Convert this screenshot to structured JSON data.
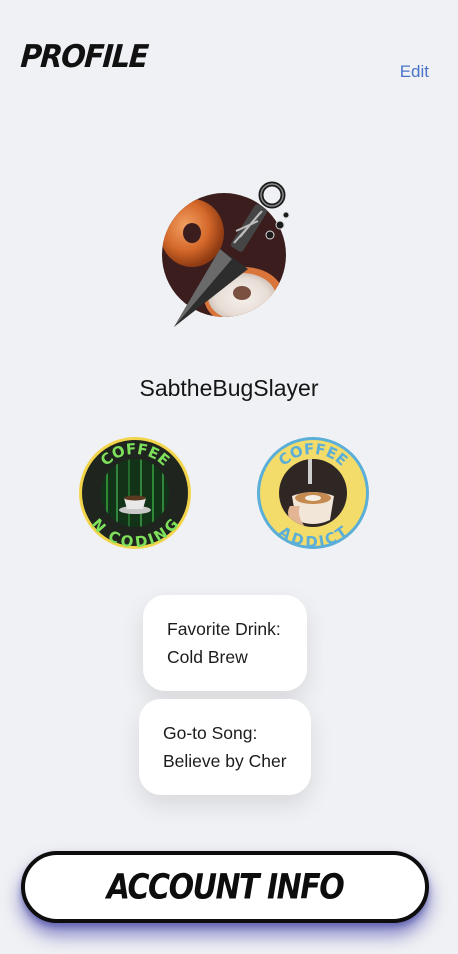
{
  "header": {
    "title": "PROFILE",
    "edit_label": "Edit"
  },
  "profile": {
    "avatar_icon": "bagel-kunai-icon",
    "username": "SabtheBugSlayer"
  },
  "badges": [
    {
      "icon": "coffee-n-coding-badge-icon",
      "top_text": "COFFEE",
      "bottom_text": "N CODING"
    },
    {
      "icon": "coffee-addict-badge-icon",
      "top_text": "COFFEE",
      "bottom_text": "ADDICT"
    }
  ],
  "cards": {
    "drink": {
      "label": "Favorite Drink:",
      "value": "Cold Brew"
    },
    "song": {
      "label": "Go-to Song:",
      "value": "Believe by Cher"
    }
  },
  "footer": {
    "button_label": "ACCOUNT INFO"
  },
  "colors": {
    "background": "#f0f1f4",
    "edit_link": "#4a74c9",
    "button_shadow": "#3b3bbf",
    "badge_green_text": "#7ee05a",
    "badge_blue_ring": "#5aaed8",
    "badge_yellow": "#f4dc6a"
  }
}
